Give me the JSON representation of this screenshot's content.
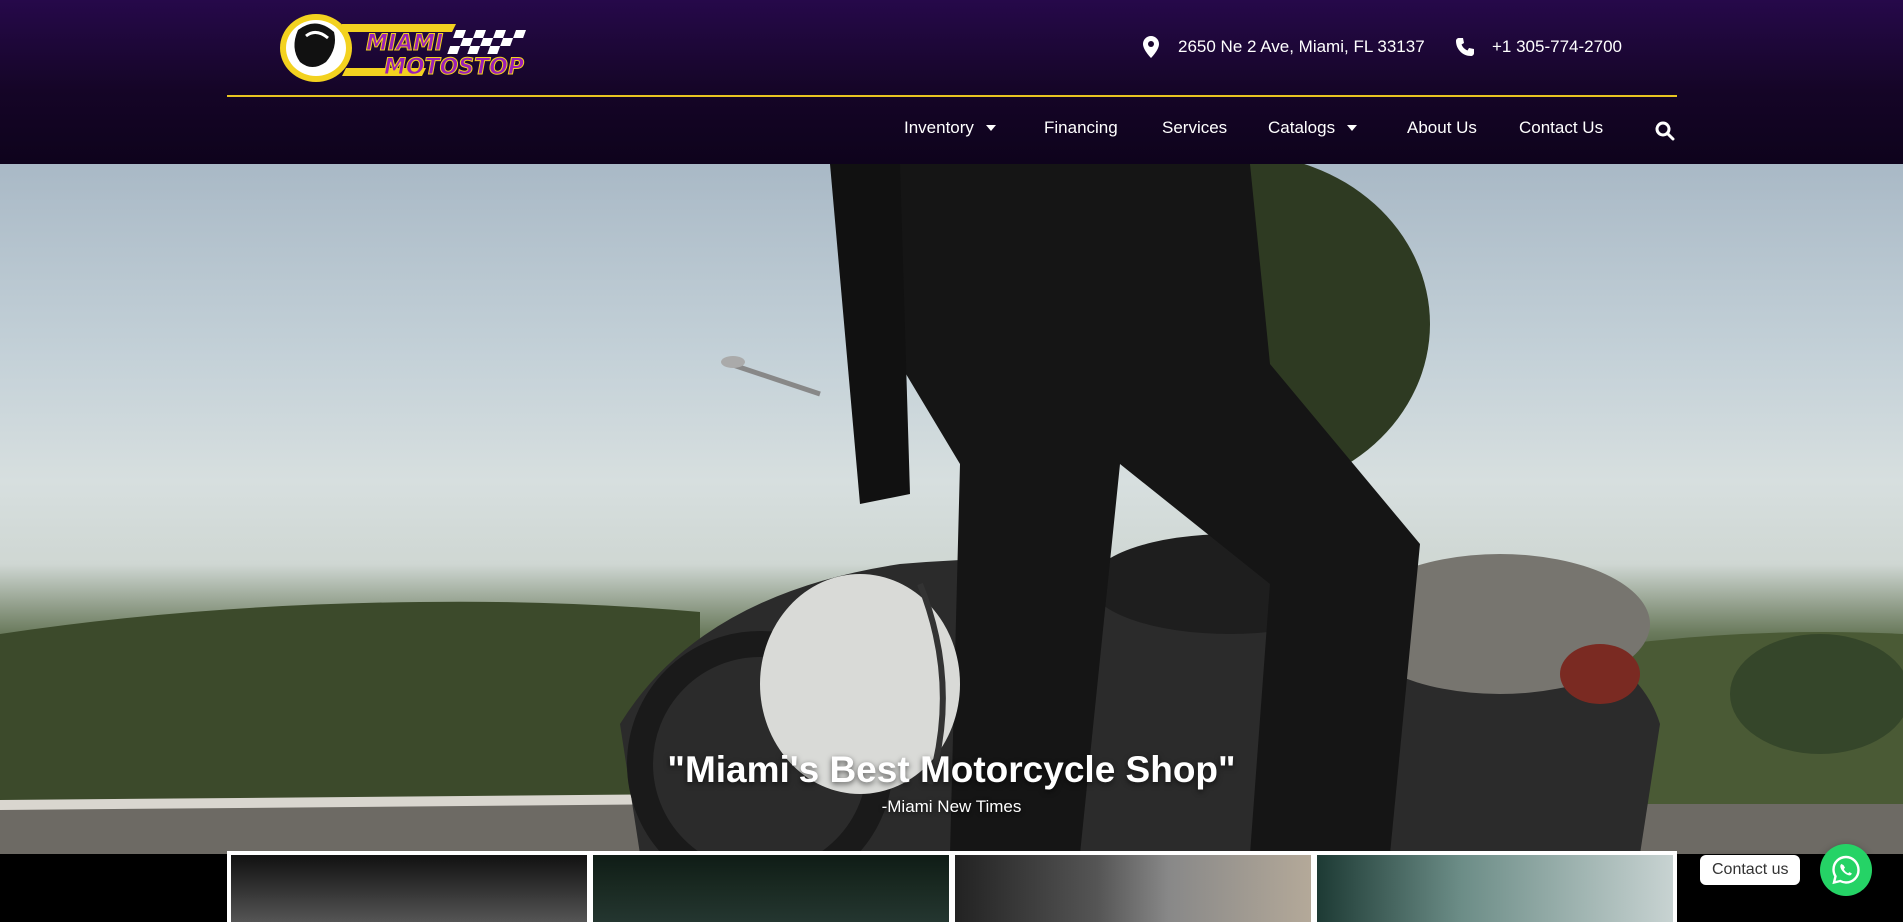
{
  "header": {
    "logo_text_line1": "MIAMI",
    "logo_text_line2": "MOTOSTOP",
    "address": "2650 Ne 2 Ave, Miami, FL 33137",
    "phone": "+1 305-774-2700",
    "address_icon": "map-marker-icon",
    "phone_icon": "phone-icon"
  },
  "nav": {
    "items": [
      {
        "label": "Inventory",
        "has_dropdown": true
      },
      {
        "label": "Financing",
        "has_dropdown": false
      },
      {
        "label": "Services",
        "has_dropdown": false
      },
      {
        "label": "Catalogs",
        "has_dropdown": true
      },
      {
        "label": "About Us",
        "has_dropdown": false
      },
      {
        "label": "Contact Us",
        "has_dropdown": false
      }
    ],
    "search_icon": "search-icon"
  },
  "hero": {
    "quote": "\"Miami's Best Motorcycle Shop\"",
    "attribution": "-Miami New Times"
  },
  "floating": {
    "contact_label": "Contact us",
    "icon": "whatsapp-icon"
  },
  "colors": {
    "header_bg": "#150527",
    "accent_yellow": "#e8c521",
    "brand_purple": "#8a1fa8",
    "whatsapp_green": "#25d366"
  }
}
